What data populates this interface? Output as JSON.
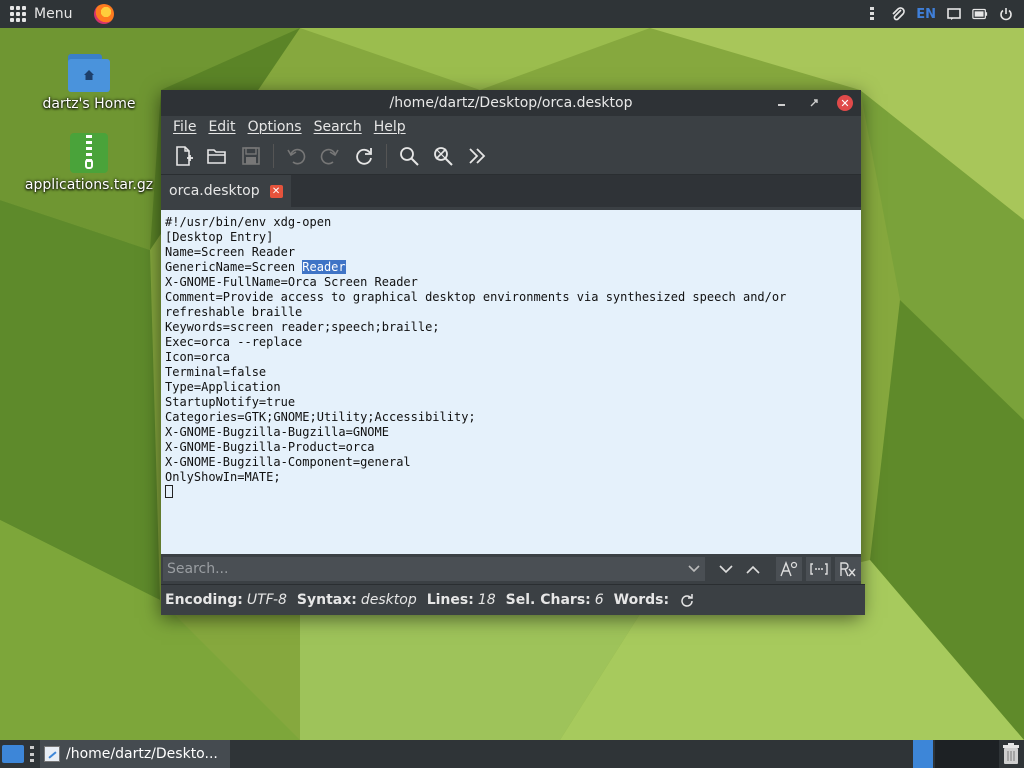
{
  "top_panel": {
    "menu_label": "Menu",
    "language": "EN"
  },
  "desktop": {
    "icons": [
      {
        "label": "dartz's Home",
        "icon": "home-folder-icon"
      },
      {
        "label": "applications.tar.gz",
        "icon": "archive-icon"
      }
    ]
  },
  "window": {
    "title": "/home/dartz/Desktop/orca.desktop",
    "menus": [
      "File",
      "Edit",
      "Options",
      "Search",
      "Help"
    ],
    "tab_label": "orca.desktop",
    "file_lines": [
      "#!/usr/bin/env xdg-open",
      "[Desktop Entry]",
      "Name=Screen Reader",
      "GenericName=Screen ",
      "X-GNOME-FullName=Orca Screen Reader",
      "Comment=Provide access to graphical desktop environments via synthesized speech and/or",
      "refreshable braille",
      "Keywords=screen reader;speech;braille;",
      "Exec=orca --replace",
      "Icon=orca",
      "Terminal=false",
      "Type=Application",
      "StartupNotify=true",
      "Categories=GTK;GNOME;Utility;Accessibility;",
      "X-GNOME-Bugzilla-Bugzilla=GNOME",
      "X-GNOME-Bugzilla-Product=orca",
      "X-GNOME-Bugzilla-Component=general",
      "OnlyShowIn=MATE;"
    ],
    "selected_text": "Reader",
    "search_placeholder": "Search...",
    "status": {
      "encoding_label": "Encoding:",
      "encoding_value": "UTF-8",
      "syntax_label": "Syntax:",
      "syntax_value": "desktop",
      "lines_label": "Lines:",
      "lines_value": "18",
      "selchars_label": "Sel. Chars:",
      "selchars_value": "6",
      "words_label": "Words:"
    }
  },
  "taskbar": {
    "task_label": "/home/dartz/Deskto..."
  },
  "colors": {
    "editor_bg": "#e5f1fb",
    "selection": "#3f74c6",
    "panel": "#2f3437",
    "accent": "#3d86d8"
  }
}
